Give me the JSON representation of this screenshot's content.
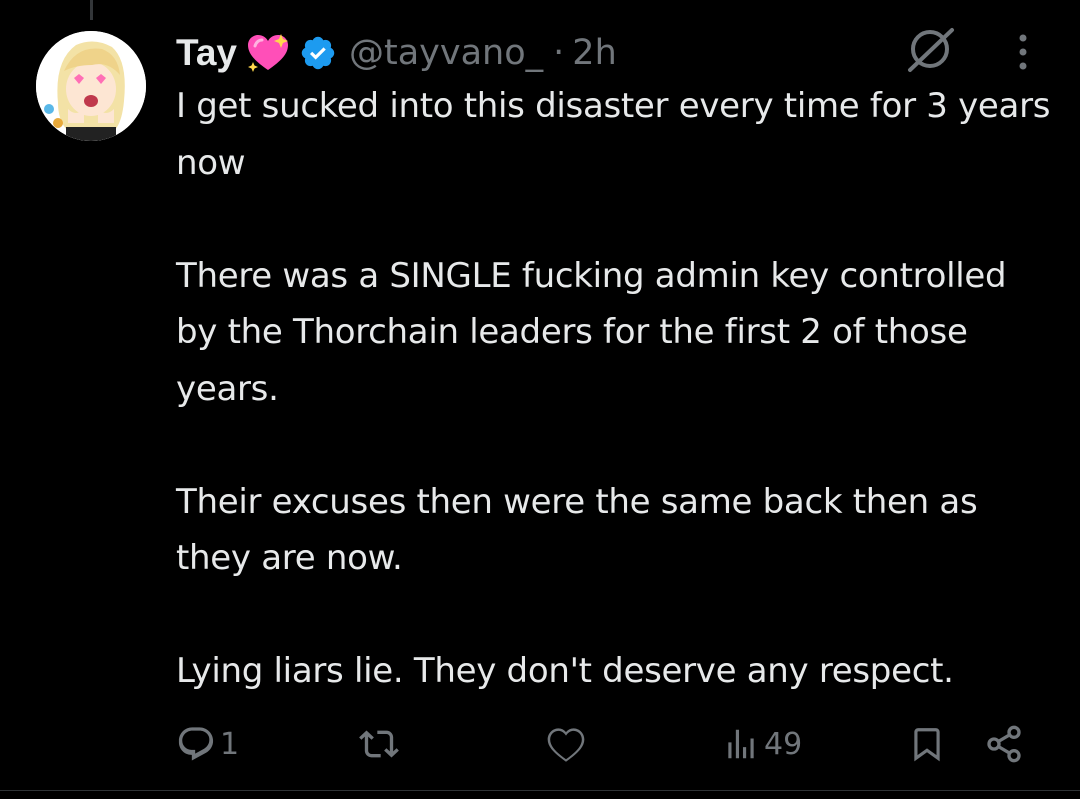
{
  "tweet": {
    "author_name": "Tay",
    "handle": "@tayvano_",
    "separator": "·",
    "time": "2h",
    "paragraphs": [
      "I get sucked into this disaster every time for 3 years now",
      "There was a SINGLE fucking admin key controlled by the Thorchain leaders for the first 2 of those years.",
      "Their excuses then were the same back then as they are now.",
      "Lying liars lie. They don't deserve any respect."
    ]
  },
  "actions": {
    "reply_count": "1",
    "retweet_count": "",
    "like_count": "",
    "views_count": "49"
  },
  "icons": {
    "verified": "verified-badge-icon",
    "heart_emoji": "sparkling-heart-icon",
    "grok": "grok-icon",
    "more": "more-icon",
    "reply": "reply-icon",
    "retweet": "retweet-icon",
    "like": "heart-icon",
    "views": "views-icon",
    "bookmark": "bookmark-icon",
    "share": "share-icon"
  },
  "colors": {
    "background": "#000000",
    "text": "#e7e9ea",
    "muted": "#71767b",
    "verified": "#1d9bf0",
    "heart_emoji": "#ff4fb8"
  }
}
